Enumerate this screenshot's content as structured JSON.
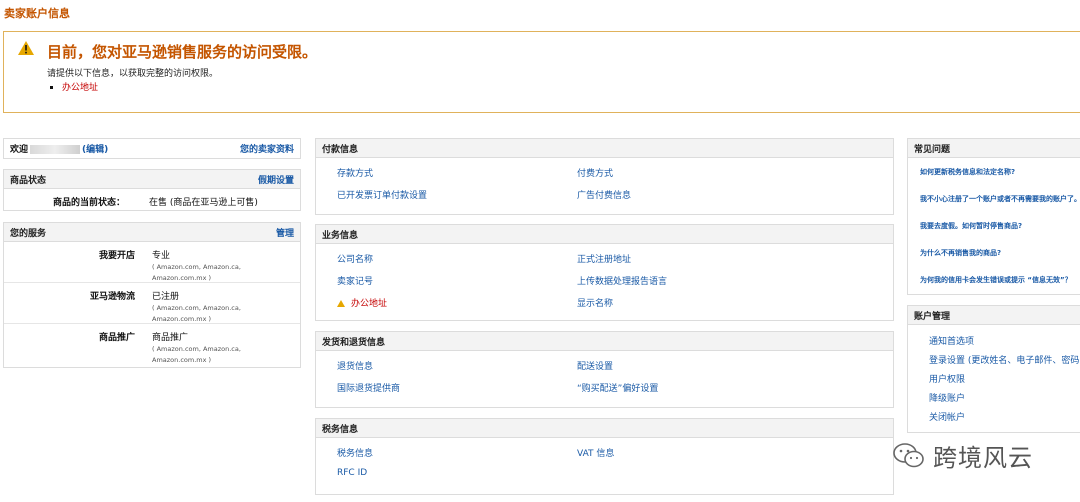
{
  "page_title": "卖家账户信息",
  "alert": {
    "headline": "目前，您对亚马逊销售服务的访问受限。",
    "subline": "请提供以下信息，以获取完整的访问权限。",
    "items": [
      "办公地址"
    ]
  },
  "welcome": {
    "prefix": "欢迎",
    "edit_link": "(编辑)",
    "profile_link": "您的卖家资料"
  },
  "listing_status": {
    "title": "商品状态",
    "action": "假期设置",
    "label": "商品的当前状态：",
    "value": "在售 (商品在亚马逊上可售)"
  },
  "services": {
    "title": "您的服务",
    "action": "管理",
    "rows": [
      {
        "label": "我要开店",
        "value": "专业",
        "markets": "( Amazon.com, Amazon.ca,",
        "markets2": "Amazon.com.mx )"
      },
      {
        "label": "亚马逊物流",
        "value": "已注册",
        "markets": "( Amazon.com, Amazon.ca,",
        "markets2": "Amazon.com.mx )"
      },
      {
        "label": "商品推广",
        "value": "商品推广",
        "markets": "( Amazon.com, Amazon.ca,",
        "markets2": "Amazon.com.mx )"
      }
    ]
  },
  "payment": {
    "title": "付款信息",
    "links": [
      "存款方式",
      "付费方式",
      "已开发票订单付款设置",
      "广告付费信息"
    ]
  },
  "business": {
    "title": "业务信息",
    "links": [
      "公司名称",
      "正式注册地址",
      "卖家记号",
      "上传数据处理报告语言",
      "办公地址",
      "显示名称"
    ]
  },
  "shipping": {
    "title": "发货和退货信息",
    "links": [
      "退货信息",
      "配送设置",
      "国际退货提供商",
      "“购买配送”偏好设置"
    ]
  },
  "tax": {
    "title": "税务信息",
    "links": [
      "税务信息",
      "VAT 信息",
      "RFC ID"
    ]
  },
  "faq": {
    "title": "常见问题",
    "links": [
      "如何更新税务信息和法定名称?",
      "我不小心注册了一个账户或者不再需要我的账户了。我",
      "我要去度假。如何暂时停售商品?",
      "为什么不再销售我的商品?",
      "为何我的信用卡会发生错误或提示 “信息无效”？"
    ]
  },
  "account": {
    "title": "账户管理",
    "links": [
      "通知首选项",
      "登录设置 (更改姓名、电子邮件、密码",
      "用户权限",
      "降级账户",
      "关闭帐户"
    ]
  },
  "watermark": "跨境风云",
  "colors": {
    "accent": "#c45500",
    "link": "#1a5aa6",
    "alert_border": "#e0b25b",
    "error": "#c40000"
  }
}
